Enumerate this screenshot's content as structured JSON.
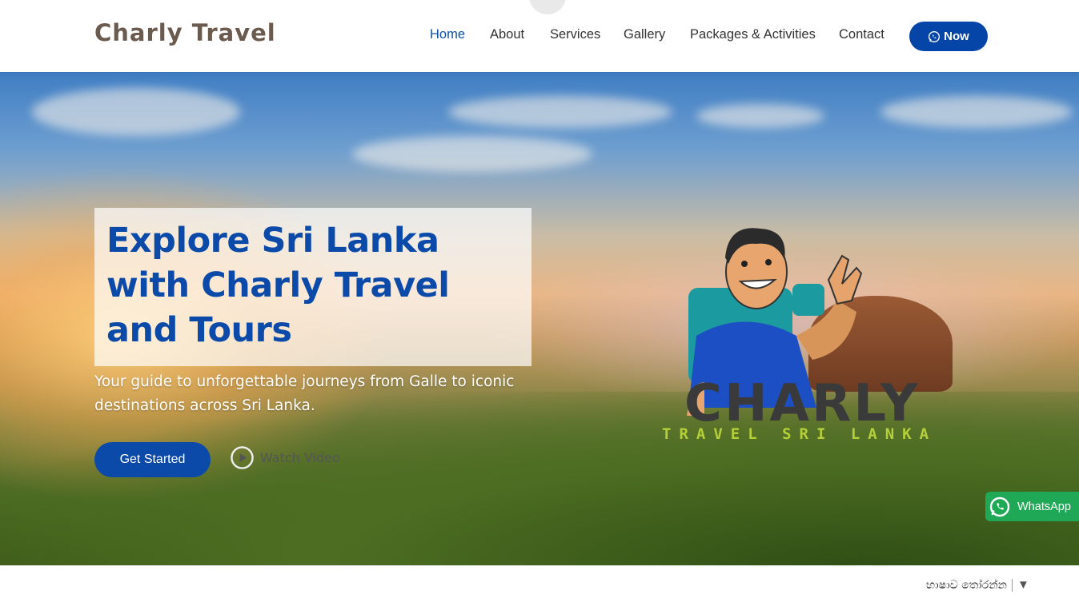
{
  "header": {
    "logo": "Charly Travel",
    "nav": [
      {
        "label": "Home",
        "active": true
      },
      {
        "label": "About"
      },
      {
        "label": "Services"
      },
      {
        "label": "Gallery"
      },
      {
        "label": "Packages & Activities"
      },
      {
        "label": "Contact"
      }
    ],
    "cta_label": "Now",
    "cta_icon": "whatsapp-icon"
  },
  "hero": {
    "title": "Explore Sri Lanka with Charly Travel and Tours",
    "subtitle": "Your guide to unforgettable journeys from Galle to iconic destinations across Sri Lanka.",
    "primary_button": "Get Started",
    "secondary_button": "Watch Video",
    "secondary_icon": "play-circle-icon",
    "brand_logo": {
      "name": "CHARLY",
      "tagline": "TRAVEL SRI LANKA"
    }
  },
  "floating_whatsapp": {
    "label": "WhatsApp",
    "icon": "whatsapp-icon"
  },
  "language": {
    "label": "භාෂාව තෝරන්න",
    "icon": "dropdown-arrow-icon"
  },
  "colors": {
    "brand_blue": "#0b4aa8",
    "logo_brown": "#6b5a4e",
    "whatsapp_green": "#1fa855",
    "tagline_green": "#b5cf3a"
  }
}
